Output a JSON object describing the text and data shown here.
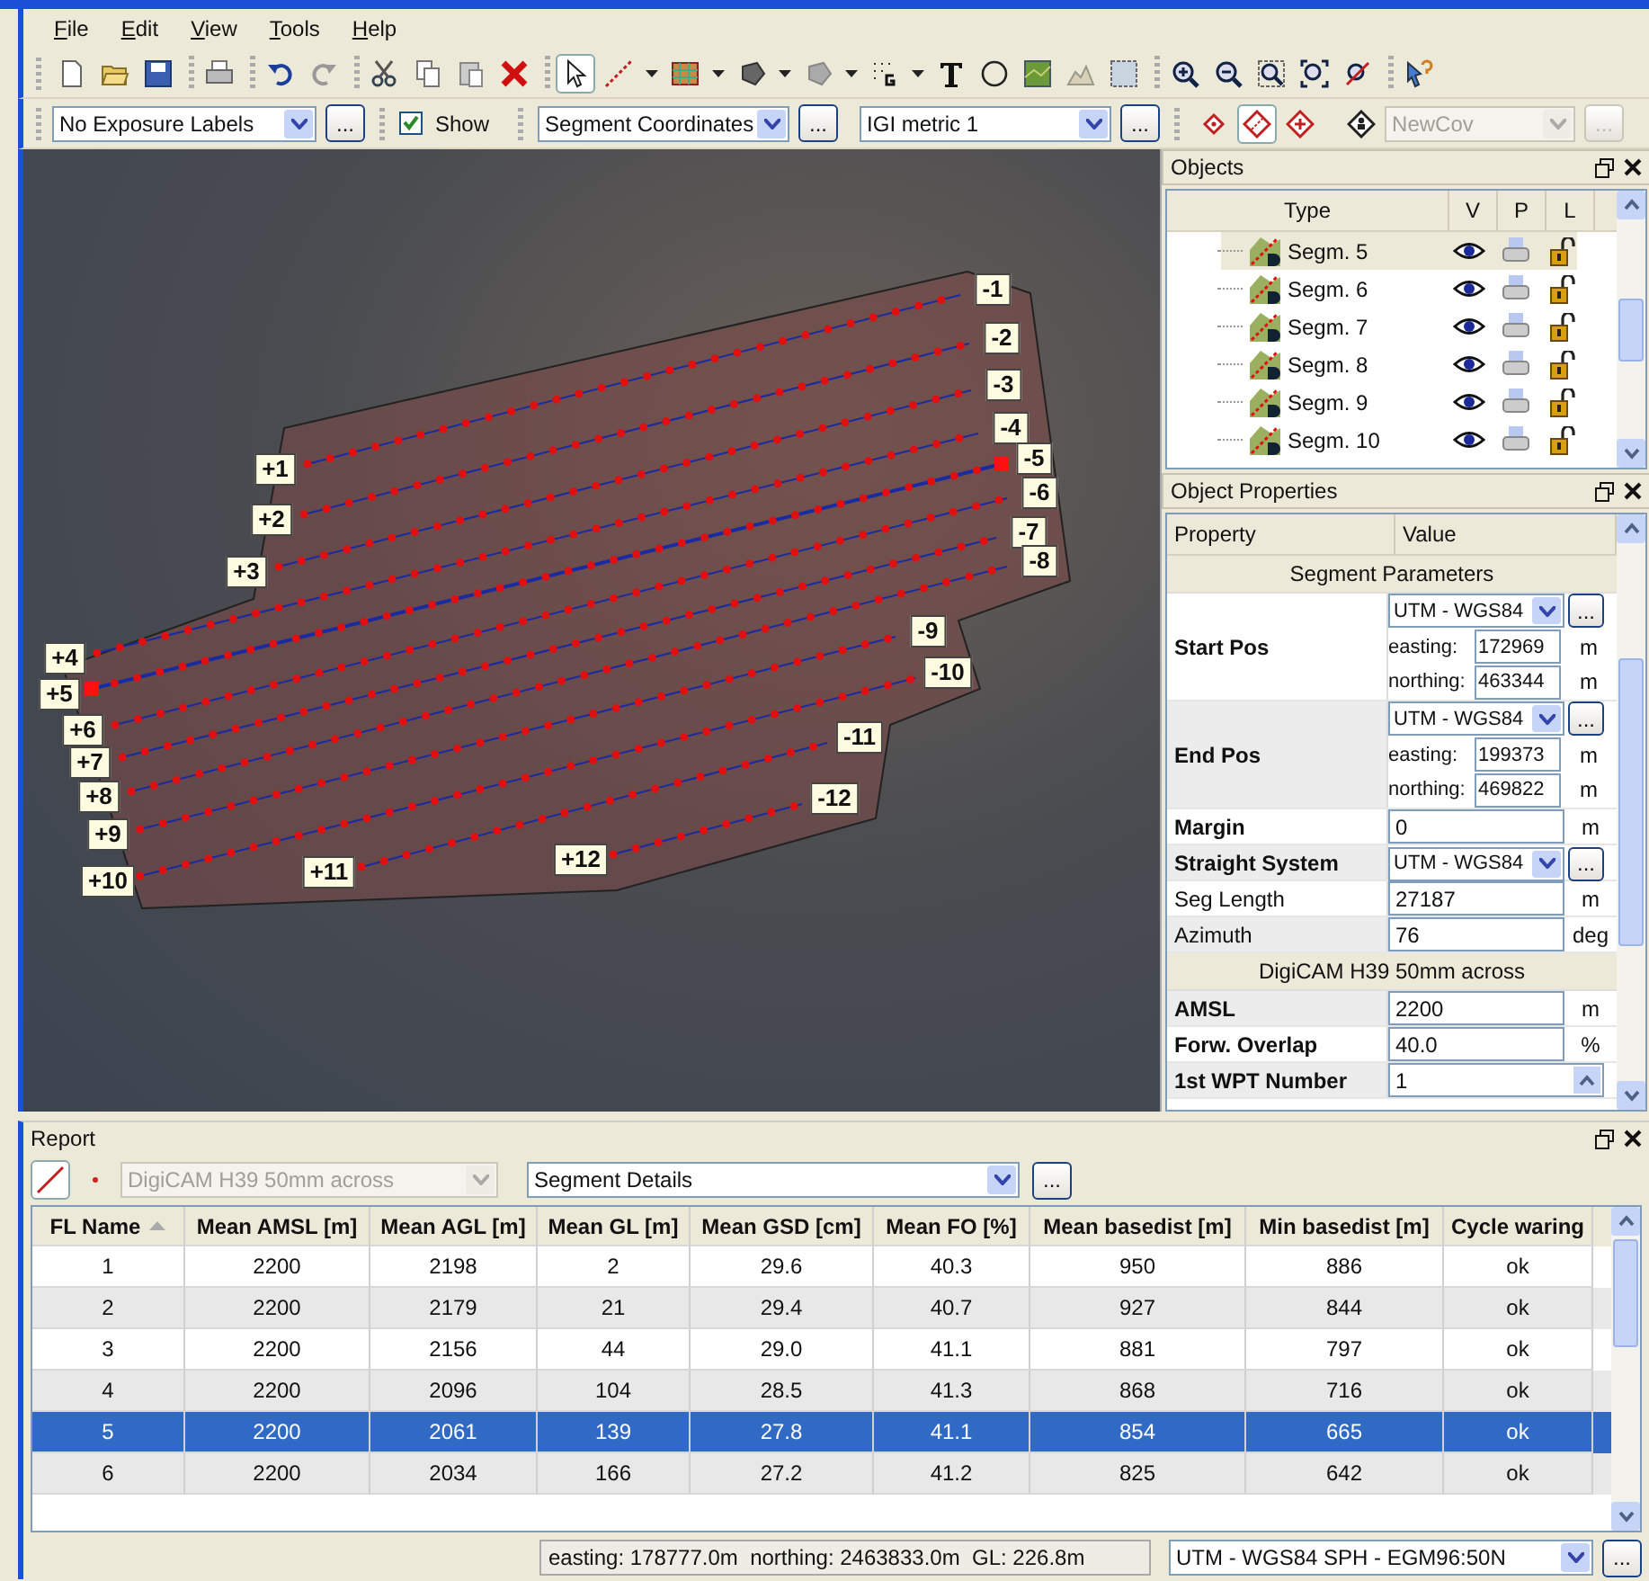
{
  "menu": [
    "File",
    "Edit",
    "View",
    "Tools",
    "Help"
  ],
  "options_bar": {
    "exposure_labels": {
      "value": "No Exposure Labels",
      "button": "..."
    },
    "show": {
      "label": "Show",
      "checked": true
    },
    "coordinates": {
      "value": "Segment Coordinates",
      "button": "..."
    },
    "metric": {
      "value": "IGI metric 1",
      "button": "..."
    },
    "coverage": {
      "value": "NewCov",
      "button": "...",
      "disabled": true
    }
  },
  "map": {
    "lines": [
      {
        "start_label": "+1",
        "end_label": "-1",
        "selected": false
      },
      {
        "start_label": "+2",
        "end_label": "-2",
        "selected": false
      },
      {
        "start_label": "+3",
        "end_label": "-3",
        "selected": false
      },
      {
        "start_label": "+4",
        "end_label": "-4",
        "selected": false
      },
      {
        "start_label": "+5",
        "end_label": "-5",
        "selected": true
      },
      {
        "start_label": "+6",
        "end_label": "-6",
        "selected": false
      },
      {
        "start_label": "+7",
        "end_label": "-7",
        "selected": false
      },
      {
        "start_label": "+8",
        "end_label": "-8",
        "selected": false
      },
      {
        "start_label": "+9",
        "end_label": "-9",
        "selected": false
      },
      {
        "start_label": "+10",
        "end_label": "-10",
        "selected": false
      },
      {
        "start_label": "+11",
        "end_label": "-11",
        "selected": false
      },
      {
        "start_label": "+12",
        "end_label": "-12",
        "selected": false
      }
    ]
  },
  "objects": {
    "title": "Objects",
    "columns": [
      "Type",
      "V",
      "P",
      "L"
    ],
    "rows": [
      {
        "name": "Segm. 5",
        "selected": true
      },
      {
        "name": "Segm. 6",
        "selected": false
      },
      {
        "name": "Segm. 7",
        "selected": false
      },
      {
        "name": "Segm. 8",
        "selected": false
      },
      {
        "name": "Segm. 9",
        "selected": false
      },
      {
        "name": "Segm. 10",
        "selected": false
      }
    ]
  },
  "properties": {
    "title": "Object Properties",
    "columns": [
      "Property",
      "Value"
    ],
    "rows": [
      {
        "kind": "section",
        "label": "Segment Parameters"
      },
      {
        "kind": "position",
        "label": "Start Pos",
        "bold": true,
        "system": "UTM - WGS84",
        "button": "...",
        "easting_label": "easting:",
        "easting": "172969",
        "easting_unit": "m",
        "northing_label": "northing:",
        "northing": "463344",
        "northing_unit": "m"
      },
      {
        "kind": "position",
        "label": "End Pos",
        "bold": true,
        "system": "UTM - WGS84",
        "button": "...",
        "easting_label": "easting:",
        "easting": "199373",
        "easting_unit": "m",
        "northing_label": "northing:",
        "northing": "469822",
        "northing_unit": "m"
      },
      {
        "kind": "value",
        "label": "Margin",
        "bold": true,
        "value": "0",
        "unit": "m"
      },
      {
        "kind": "system",
        "label": "Straight System",
        "bold": true,
        "value": "UTM - WGS84",
        "button": "..."
      },
      {
        "kind": "value",
        "label": "Seg Length",
        "bold": false,
        "value": "27187",
        "unit": "m"
      },
      {
        "kind": "value",
        "label": "Azimuth",
        "bold": false,
        "value": "76",
        "unit": "deg"
      },
      {
        "kind": "section",
        "label": "DigiCAM H39 50mm across"
      },
      {
        "kind": "value",
        "label": "AMSL",
        "bold": true,
        "value": "2200",
        "unit": "m"
      },
      {
        "kind": "value",
        "label": "Forw. Overlap",
        "bold": true,
        "value": "40.0",
        "unit": "%"
      },
      {
        "kind": "spin",
        "label": "1st WPT Number",
        "bold": true,
        "value": "1"
      }
    ]
  },
  "report": {
    "title": "Report",
    "camera": {
      "value": "DigiCAM H39 50mm across",
      "disabled": true
    },
    "view": {
      "value": "Segment Details",
      "button": "..."
    },
    "columns": [
      "FL Name",
      "Mean AMSL [m]",
      "Mean AGL [m]",
      "Mean GL [m]",
      "Mean GSD [cm]",
      "Mean FO [%]",
      "Mean basedist [m]",
      "Min basedist [m]",
      "Cycle waring"
    ],
    "rows": [
      {
        "cells": [
          "1",
          "2200",
          "2198",
          "2",
          "29.6",
          "40.3",
          "950",
          "886",
          "ok"
        ],
        "selected": false
      },
      {
        "cells": [
          "2",
          "2200",
          "2179",
          "21",
          "29.4",
          "40.7",
          "927",
          "844",
          "ok"
        ],
        "selected": false
      },
      {
        "cells": [
          "3",
          "2200",
          "2156",
          "44",
          "29.0",
          "41.1",
          "881",
          "797",
          "ok"
        ],
        "selected": false
      },
      {
        "cells": [
          "4",
          "2200",
          "2096",
          "104",
          "28.5",
          "41.3",
          "868",
          "716",
          "ok"
        ],
        "selected": false
      },
      {
        "cells": [
          "5",
          "2200",
          "2061",
          "139",
          "27.8",
          "41.1",
          "854",
          "665",
          "ok"
        ],
        "selected": true
      },
      {
        "cells": [
          "6",
          "2200",
          "2034",
          "166",
          "27.2",
          "41.2",
          "825",
          "642",
          "ok"
        ],
        "selected": false
      }
    ]
  },
  "status_bar": {
    "position": "easting: 178777.0m  northing: 2463833.0m  GL: 226.8m",
    "system": "UTM - WGS84 SPH - EGM96:50N",
    "button": "..."
  }
}
